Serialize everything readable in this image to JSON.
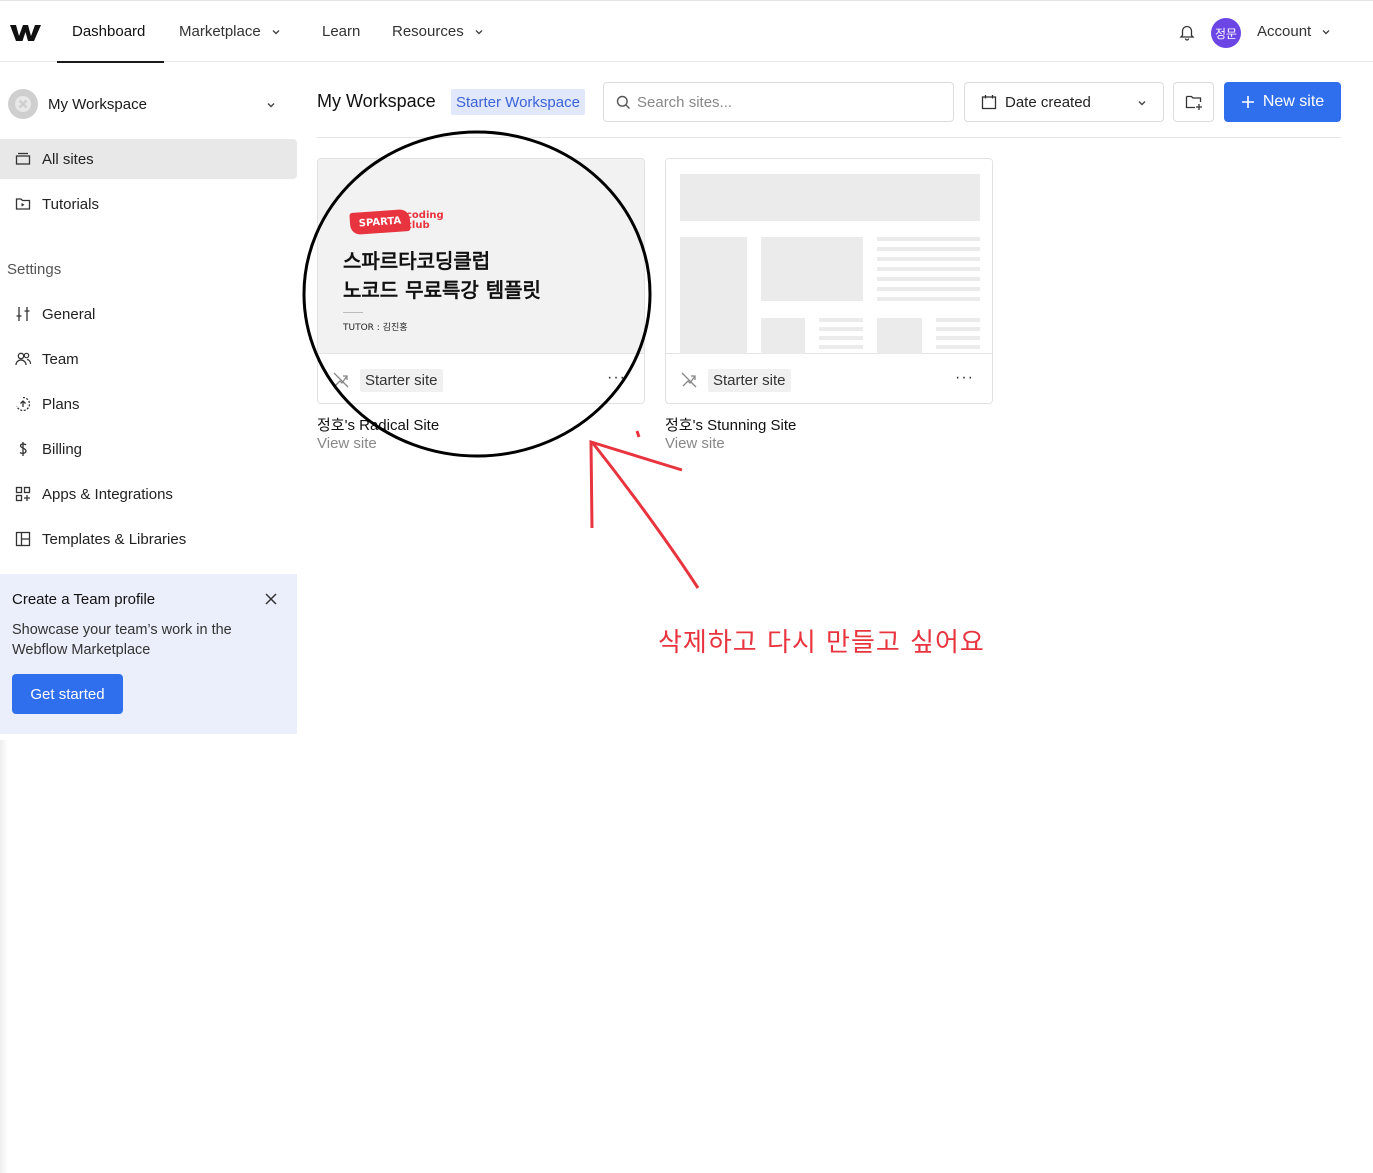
{
  "nav": {
    "dashboard": "Dashboard",
    "marketplace": "Marketplace",
    "learn": "Learn",
    "resources": "Resources",
    "avatar_initials": "정문",
    "account": "Account"
  },
  "sidebar": {
    "workspace_name": "My Workspace",
    "items": [
      {
        "label": "All sites",
        "icon": "layers-icon"
      },
      {
        "label": "Tutorials",
        "icon": "tutorial-icon"
      }
    ],
    "settings_heading": "Settings",
    "settings_items": [
      {
        "label": "General",
        "icon": "sliders-icon"
      },
      {
        "label": "Team",
        "icon": "users-icon"
      },
      {
        "label": "Plans",
        "icon": "plans-icon"
      },
      {
        "label": "Billing",
        "icon": "dollar-icon"
      },
      {
        "label": "Apps & Integrations",
        "icon": "apps-icon"
      },
      {
        "label": "Templates & Libraries",
        "icon": "templates-icon"
      }
    ],
    "promo": {
      "title": "Create a Team profile",
      "text": "Showcase your team’s work in the Webflow Marketplace",
      "button": "Get started"
    }
  },
  "main": {
    "title": "My Workspace",
    "badge": "Starter Workspace",
    "search_placeholder": "Search sites...",
    "sort_label": "Date created",
    "new_site": "New site",
    "sites": [
      {
        "name": "정호's Radical Site",
        "link": "View site",
        "tag": "Starter site",
        "thumb": {
          "logo": "SPARTA",
          "logo_sub_1": "coding",
          "logo_sub_2": "club",
          "title_line_1": "스파르타코딩클럽",
          "title_line_2": "노코드 무료특강 템플릿",
          "tutor": "TUTOR : 김진홍"
        }
      },
      {
        "name": "정호's Stunning Site",
        "link": "View site",
        "tag": "Starter site"
      }
    ]
  },
  "annotation": {
    "text": "삭제하고 다시 만들고 싶어요",
    "color": "#e8343e"
  },
  "colors": {
    "accent": "#2f6fed",
    "badge_bg": "#e1e8fb",
    "avatar": "#6b46e5"
  }
}
